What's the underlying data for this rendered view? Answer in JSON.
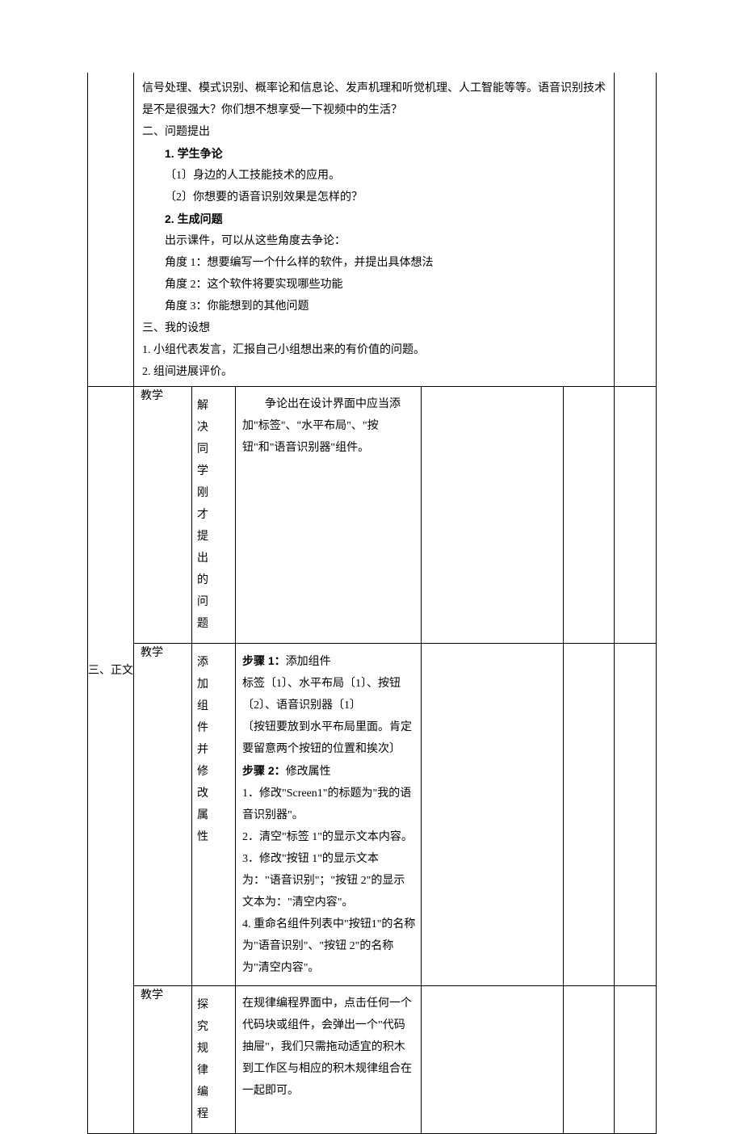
{
  "intro": {
    "para1": "信号处理、模式识别、概率论和信息论、发声机理和听觉机理、人工智能等等。语音识别技术是不是很强大？你们想不想享受一下视频中的生活？",
    "heading2": "二、问题提出",
    "h2_1": "1. 学生争论",
    "h2_1_item1": "〔1〕身边的人工技能技术的应用。",
    "h2_1_item2": "〔2〕你想要的语音识别效果是怎样的？",
    "h2_2": "2. 生成问题",
    "h2_2_intro": "出示课件，可以从这些角度去争论：",
    "h2_2_a1": "角度 1：想要编写一个什么样的软件，并提出具体想法",
    "h2_2_a2": "角度 2：这个软件将要实现哪些功能",
    "h2_2_a3": "角度 3：你能想到的其他问题",
    "heading3": "三、我的设想",
    "h3_1": "1. 小组代表发言，汇报自己小组想出来的有价值的问题。",
    "h3_2": "2. 组间进展评价。"
  },
  "section_label": "三、正文",
  "rows": [
    {
      "col2": "教学",
      "col3": "解决同学刚才提出的问题",
      "col4": "　　争论出在设计界面中应当添加\"标签\"、\"水平布局\"、\"按钮\"和\"语音识别器\"组件。"
    },
    {
      "col2": "教学",
      "col3": "添加组件并修改属性",
      "col4_lines": [
        {
          "bold": true,
          "text": "步骤 1："
        },
        {
          "text": "添加组件"
        },
        {
          "br": true,
          "text": "标签〔1〕、水平布局〔1〕、按钮〔2〕、语音识别器〔1〕"
        },
        {
          "br": true,
          "text": "〔按钮要放到水平布局里面。肯定要留意两个按钮的位置和挨次〕"
        },
        {
          "br": true,
          "bold": true,
          "text": "步骤 2："
        },
        {
          "text": "修改属性"
        },
        {
          "br": true,
          "text": "1．修改\"Screen1\"的标题为\"我的语音识别器\"。"
        },
        {
          "br": true,
          "text": "2．清空\"标签 1\"的显示文本内容。"
        },
        {
          "br": true,
          "text": "3．修改\"按钮 1\"的显示文本为：\"语音识别\"；\"按钮 2\"的显示文本为：\"清空内容\"。"
        },
        {
          "br": true,
          "text": "4. 重命名组件列表中\"按钮1\"的名称为\"语音识别\"、\"按钮 2\"的名称为\"清空内容\"。"
        }
      ]
    },
    {
      "col2": "教学",
      "col3": "探究规律编程",
      "col4": "在规律编程界面中，点击任何一个代码块或组件，会弹出一个\"代码抽屉\"，我们只需拖动适宜的积木到工作区与相应的积木规律组合在一起即可。"
    }
  ]
}
